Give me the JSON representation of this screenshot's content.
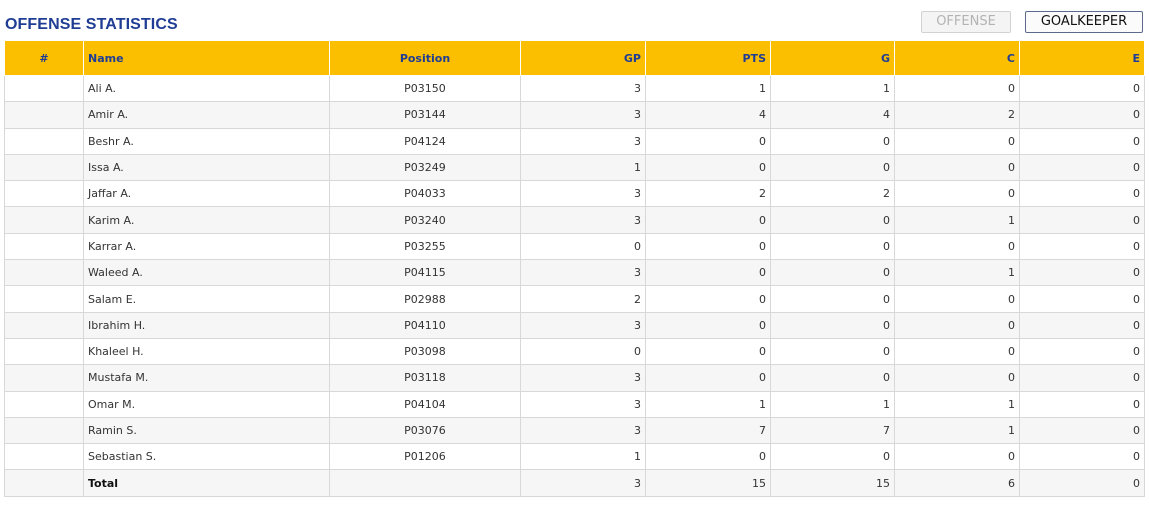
{
  "header": {
    "title": "OFFENSE STATISTICS",
    "tabs": {
      "offense": "OFFENSE",
      "goalkeeper": "GOALKEEPER"
    }
  },
  "table": {
    "columns": {
      "num": "#",
      "name": "Name",
      "position": "Position",
      "gp": "GP",
      "pts": "PTS",
      "g": "G",
      "c": "C",
      "e": "E"
    },
    "rows": [
      {
        "num": "",
        "name": "Ali A.",
        "position": "P03150",
        "gp": "3",
        "pts": "1",
        "g": "1",
        "c": "0",
        "e": "0"
      },
      {
        "num": "",
        "name": "Amir A.",
        "position": "P03144",
        "gp": "3",
        "pts": "4",
        "g": "4",
        "c": "2",
        "e": "0"
      },
      {
        "num": "",
        "name": "Beshr A.",
        "position": "P04124",
        "gp": "3",
        "pts": "0",
        "g": "0",
        "c": "0",
        "e": "0"
      },
      {
        "num": "",
        "name": "Issa A.",
        "position": "P03249",
        "gp": "1",
        "pts": "0",
        "g": "0",
        "c": "0",
        "e": "0"
      },
      {
        "num": "",
        "name": "Jaffar A.",
        "position": "P04033",
        "gp": "3",
        "pts": "2",
        "g": "2",
        "c": "0",
        "e": "0"
      },
      {
        "num": "",
        "name": "Karim A.",
        "position": "P03240",
        "gp": "3",
        "pts": "0",
        "g": "0",
        "c": "1",
        "e": "0"
      },
      {
        "num": "",
        "name": "Karrar A.",
        "position": "P03255",
        "gp": "0",
        "pts": "0",
        "g": "0",
        "c": "0",
        "e": "0"
      },
      {
        "num": "",
        "name": "Waleed A.",
        "position": "P04115",
        "gp": "3",
        "pts": "0",
        "g": "0",
        "c": "1",
        "e": "0"
      },
      {
        "num": "",
        "name": "Salam E.",
        "position": "P02988",
        "gp": "2",
        "pts": "0",
        "g": "0",
        "c": "0",
        "e": "0"
      },
      {
        "num": "",
        "name": "Ibrahim H.",
        "position": "P04110",
        "gp": "3",
        "pts": "0",
        "g": "0",
        "c": "0",
        "e": "0"
      },
      {
        "num": "",
        "name": "Khaleel H.",
        "position": "P03098",
        "gp": "0",
        "pts": "0",
        "g": "0",
        "c": "0",
        "e": "0"
      },
      {
        "num": "",
        "name": "Mustafa M.",
        "position": "P03118",
        "gp": "3",
        "pts": "0",
        "g": "0",
        "c": "0",
        "e": "0"
      },
      {
        "num": "",
        "name": "Omar M.",
        "position": "P04104",
        "gp": "3",
        "pts": "1",
        "g": "1",
        "c": "1",
        "e": "0"
      },
      {
        "num": "",
        "name": "Ramin S.",
        "position": "P03076",
        "gp": "3",
        "pts": "7",
        "g": "7",
        "c": "1",
        "e": "0"
      },
      {
        "num": "",
        "name": "Sebastian S.",
        "position": "P01206",
        "gp": "1",
        "pts": "0",
        "g": "0",
        "c": "0",
        "e": "0"
      }
    ],
    "total": {
      "num": "",
      "name": "Total",
      "position": "",
      "gp": "3",
      "pts": "15",
      "g": "15",
      "c": "6",
      "e": "0"
    }
  },
  "colors": {
    "title": "#1f3d94",
    "header_bg": "#fcbf00",
    "header_text": "#1f3d94",
    "link": "#2a2aa6",
    "row_alt": "#f6f6f6",
    "border": "#d8d8d8"
  }
}
